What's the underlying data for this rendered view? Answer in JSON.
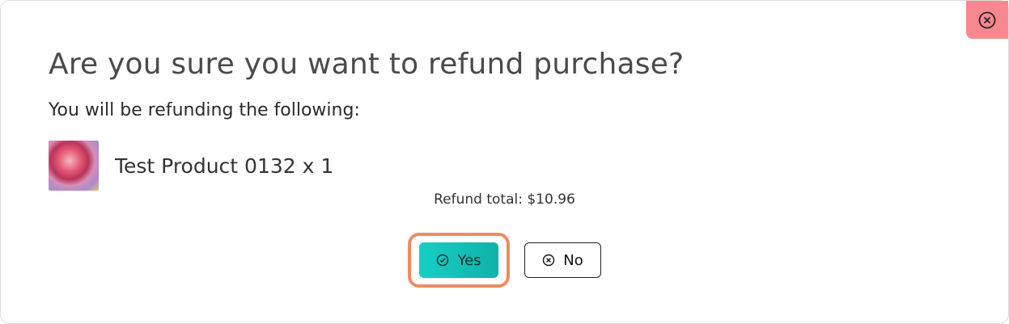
{
  "dialog": {
    "title": "Are you sure you want to refund purchase?",
    "subtitle": "You will be refunding the following:",
    "close_icon": "close-circle-icon",
    "close_color": "#f8888f"
  },
  "items": [
    {
      "name": "Test Product 0132 x 1",
      "thumbnail": "product-thumbnail"
    }
  ],
  "summary": {
    "refund_total": "Refund total: $10.96"
  },
  "actions": {
    "yes_label": "Yes",
    "yes_icon": "check-circle-icon",
    "no_label": "No",
    "no_icon": "x-circle-icon",
    "accent": "#17cfc6",
    "highlight": "#f08a60"
  }
}
